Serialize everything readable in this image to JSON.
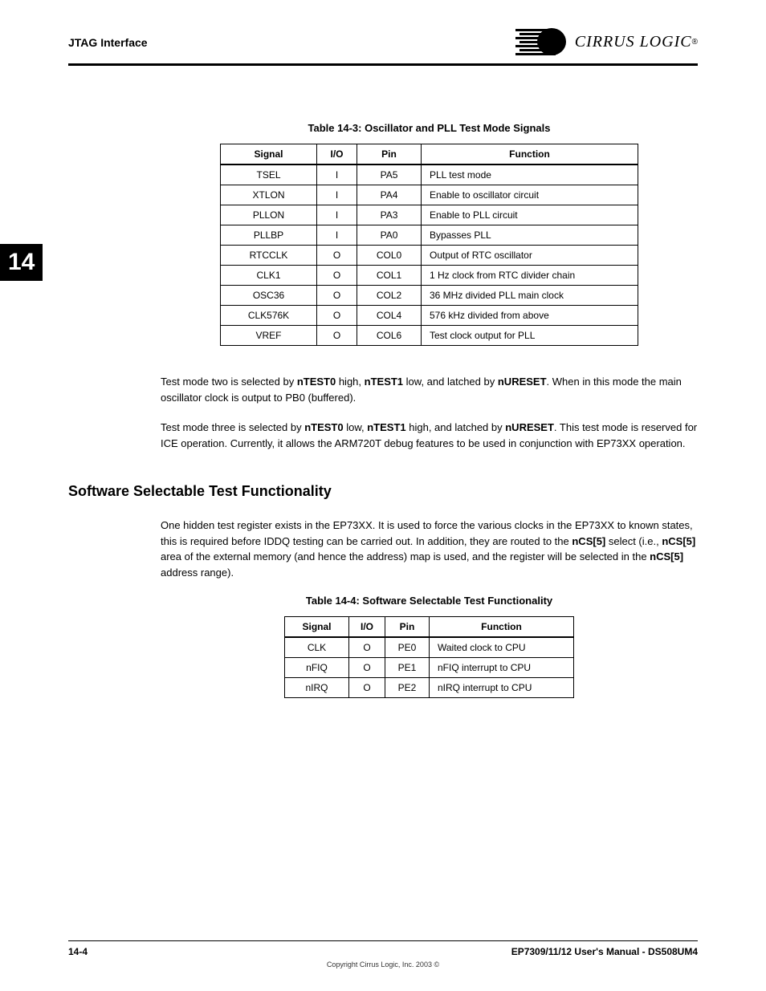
{
  "header": {
    "section": "JTAG Interface",
    "brand": "CIRRUS LOGIC"
  },
  "chapter_tab": "14",
  "table1": {
    "caption": "Table 14-3: Oscillator and PLL Test Mode Signals",
    "headers": [
      "Signal",
      "I/O",
      "Pin",
      "Function"
    ],
    "rows": [
      {
        "signal": "TSEL",
        "io": "I",
        "pin": "PA5",
        "fn": "PLL test mode"
      },
      {
        "signal": "XTLON",
        "io": "I",
        "pin": "PA4",
        "fn": "Enable to oscillator circuit"
      },
      {
        "signal": "PLLON",
        "io": "I",
        "pin": "PA3",
        "fn": "Enable to PLL circuit"
      },
      {
        "signal": "PLLBP",
        "io": "I",
        "pin": "PA0",
        "fn": "Bypasses PLL"
      },
      {
        "signal": "RTCCLK",
        "io": "O",
        "pin": "COL0",
        "fn": "Output of RTC oscillator"
      },
      {
        "signal": "CLK1",
        "io": "O",
        "pin": "COL1",
        "fn": "1 Hz clock from RTC divider chain"
      },
      {
        "signal": "OSC36",
        "io": "O",
        "pin": "COL2",
        "fn": "36 MHz divided PLL main clock"
      },
      {
        "signal": "CLK576K",
        "io": "O",
        "pin": "COL4",
        "fn": "576 kHz divided from above"
      },
      {
        "signal": "VREF",
        "io": "O",
        "pin": "COL6",
        "fn": "Test clock output for PLL"
      }
    ]
  },
  "para1": {
    "t0": "Test mode two is selected by ",
    "b0": "nTEST0",
    "t1": " high, ",
    "b1": "nTEST1",
    "t2": " low, and latched by ",
    "b2": "nURESET",
    "t3": ". When in this mode the main oscillator clock is output to PB0 (buffered)."
  },
  "para2": {
    "t0": "Test mode three is selected by ",
    "b0": "nTEST0",
    "t1": " low, ",
    "b1": "nTEST1",
    "t2": " high, and latched by ",
    "b2": "nURESET",
    "t3": ". This test mode is reserved for ICE operation. Currently, it allows ",
    "t4": "the ARM720T debug features to be used in conjunction with EP73XX operation."
  },
  "section_title": "Software Selectable Test Functionality",
  "para3": {
    "t0": "One hidden test register exists in the EP73XX. It is used to force the various ",
    "t1": "clocks in the EP73XX to known states, this is required before IDDQ testing can be ",
    "t2": "carried out. In addition, they are routed to the ",
    "b0": "nCS[5]",
    "t3": " select (i.e., ",
    "b1": "nCS[5]",
    "t4": " area of the external memory (and hence the address) map is used, and the register ",
    "t5": "will be selected in the ",
    "b2": "nCS[5]",
    "t6": " address range)."
  },
  "table2": {
    "caption": "Table 14-4: Software Selectable Test Functionality",
    "headers": [
      "Signal",
      "I/O",
      "Pin",
      "Function"
    ],
    "rows": [
      {
        "signal": "CLK",
        "io": "O",
        "pin": "PE0",
        "fn": "Waited clock to CPU"
      },
      {
        "signal": "nFIQ",
        "io": "O",
        "pin": "PE1",
        "fn": "nFIQ interrupt to CPU"
      },
      {
        "signal": "nIRQ",
        "io": "O",
        "pin": "PE2",
        "fn": "nIRQ interrupt to CPU"
      }
    ]
  },
  "footer": {
    "page": "14-4",
    "doc": "EP7309/11/12 User's Manual - DS508UM4",
    "copyright": "Copyright Cirrus Logic, Inc. 2003",
    "copyright_symbol": "©"
  }
}
